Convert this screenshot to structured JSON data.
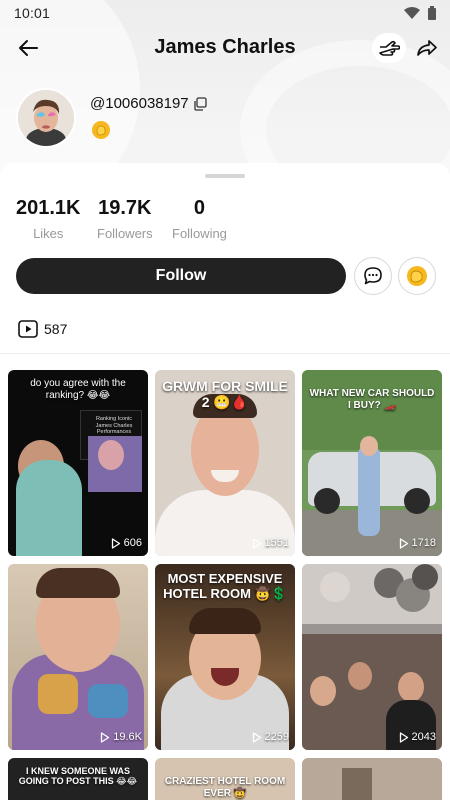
{
  "status_bar": {
    "time": "10:01"
  },
  "header": {
    "title": "James Charles"
  },
  "profile": {
    "handle": "@1006038197"
  },
  "stats": [
    {
      "value": "201.1K",
      "label": "Likes"
    },
    {
      "value": "19.7K",
      "label": "Followers"
    },
    {
      "value": "0",
      "label": "Following"
    }
  ],
  "actions": {
    "follow_label": "Follow"
  },
  "videos": {
    "count": "587",
    "items": [
      {
        "caption": "do you agree with the ranking? 😂😂",
        "inner_text": "Ranking Iconic James Charles Performances",
        "plays": "606"
      },
      {
        "caption": "GRWM FOR SMILE 2 😬🩸",
        "plays": "1551"
      },
      {
        "caption": "WHAT NEW CAR SHOULD I BUY? 🏎️",
        "plays": "1718"
      },
      {
        "caption": "",
        "plays": "19.6K"
      },
      {
        "caption": "MOST EXPENSIVE HOTEL ROOM 🤠💲",
        "plays": "2259"
      },
      {
        "caption": "",
        "plays": "2043"
      },
      {
        "caption": "I KNEW SOMEONE WAS GOING TO POST THIS 😂😂",
        "plays": ""
      },
      {
        "caption": "CRAZIEST HOTEL ROOM EVER 🤠",
        "plays": ""
      },
      {
        "caption": "",
        "plays": ""
      }
    ]
  },
  "colors": {
    "follow_bg": "#222222",
    "accent_yellow": "#f5b820"
  }
}
